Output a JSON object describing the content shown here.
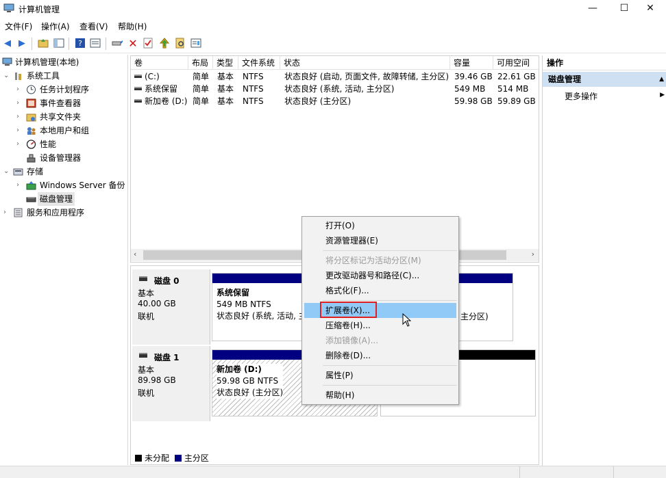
{
  "window": {
    "title": "计算机管理",
    "controls": [
      "—",
      "☐",
      "✕"
    ]
  },
  "menubar": [
    "文件(F)",
    "操作(A)",
    "查看(V)",
    "帮助(H)"
  ],
  "tree": {
    "root": "计算机管理(本地)",
    "items": [
      {
        "label": "系统工具",
        "level": 1,
        "arrow": "expanded",
        "icon": "tools-icon"
      },
      {
        "label": "任务计划程序",
        "level": 2,
        "arrow": "collapsed",
        "icon": "clock-icon"
      },
      {
        "label": "事件查看器",
        "level": 2,
        "arrow": "collapsed",
        "icon": "event-viewer-icon"
      },
      {
        "label": "共享文件夹",
        "level": 2,
        "arrow": "collapsed",
        "icon": "shared-folder-icon"
      },
      {
        "label": "本地用户和组",
        "level": 2,
        "arrow": "collapsed",
        "icon": "users-icon"
      },
      {
        "label": "性能",
        "level": 2,
        "arrow": "collapsed",
        "icon": "performance-icon"
      },
      {
        "label": "设备管理器",
        "level": 2,
        "arrow": "none",
        "icon": "device-manager-icon"
      },
      {
        "label": "存储",
        "level": 1,
        "arrow": "expanded",
        "icon": "storage-icon"
      },
      {
        "label": "Windows Server 备份",
        "level": 2,
        "arrow": "collapsed",
        "icon": "backup-icon"
      },
      {
        "label": "磁盘管理",
        "level": 2,
        "arrow": "none",
        "icon": "disk-icon",
        "selected": true
      },
      {
        "label": "服务和应用程序",
        "level": 1,
        "arrow": "collapsed",
        "icon": "services-icon"
      }
    ]
  },
  "volume_list": {
    "headers": [
      "卷",
      "布局",
      "类型",
      "文件系统",
      "状态",
      "容量",
      "可用空间"
    ],
    "rows": [
      [
        "(C:)",
        "简单",
        "基本",
        "NTFS",
        "状态良好 (启动, 页面文件, 故障转储, 主分区)",
        "39.46 GB",
        "22.61 GB"
      ],
      [
        "系统保留",
        "简单",
        "基本",
        "NTFS",
        "状态良好 (系统, 活动, 主分区)",
        "549 MB",
        "514 MB"
      ],
      [
        "新加卷 (D:)",
        "简单",
        "基本",
        "NTFS",
        "状态良好 (主分区)",
        "59.98 GB",
        "59.89 GB"
      ]
    ]
  },
  "disks": [
    {
      "name": "磁盘 0",
      "type": "基本",
      "size": "40.00 GB",
      "status": "联机",
      "partitions": [
        {
          "title": "系统保留",
          "fs": "549 MB NTFS",
          "status": "状态良好 (系统, 活动, 主"
        },
        {
          "title": "",
          "fs": "",
          "status": "主分区)"
        }
      ]
    },
    {
      "name": "磁盘 1",
      "type": "基本",
      "size": "89.98 GB",
      "status": "联机",
      "partitions": [
        {
          "title": "新加卷  (D:)",
          "fs": "59.98 GB NTFS",
          "status": "状态良好 (主分区)"
        }
      ]
    }
  ],
  "legend": {
    "unallocated": "未分配",
    "primary": "主分区"
  },
  "actions": {
    "header": "操作",
    "section": "磁盘管理",
    "more": "更多操作"
  },
  "context_menu": [
    {
      "label": "打开(O)",
      "enabled": true
    },
    {
      "label": "资源管理器(E)",
      "enabled": true
    },
    {
      "sep": true
    },
    {
      "label": "将分区标记为活动分区(M)",
      "enabled": false
    },
    {
      "label": "更改驱动器号和路径(C)...",
      "enabled": true
    },
    {
      "label": "格式化(F)...",
      "enabled": true
    },
    {
      "sep": true
    },
    {
      "label": "扩展卷(X)...",
      "enabled": true,
      "highlighted": true
    },
    {
      "label": "压缩卷(H)...",
      "enabled": true
    },
    {
      "label": "添加镜像(A)...",
      "enabled": false
    },
    {
      "label": "删除卷(D)...",
      "enabled": true
    },
    {
      "sep": true
    },
    {
      "label": "属性(P)",
      "enabled": true
    },
    {
      "sep": true
    },
    {
      "label": "帮助(H)",
      "enabled": true
    }
  ],
  "colors": {
    "primary_partition": "#000080",
    "unallocated": "#000000",
    "highlight": "#91c9f7",
    "annotation": "#e02020"
  }
}
